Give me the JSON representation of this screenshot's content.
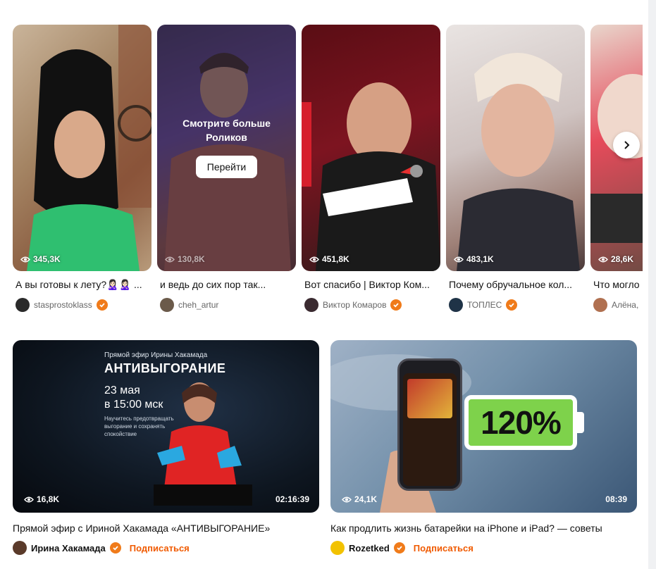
{
  "shorts": [
    {
      "views": "345,3K",
      "title": "А вы готовы к лету?🙎🏻‍♀️🙎🏻‍♀️ ...",
      "channel": "stasprostoklass",
      "verified": true,
      "avatar_color": "#2a2a2a"
    },
    {
      "views": "130,8K",
      "title": "и ведь до сих пор так...",
      "channel": "cheh_artur",
      "verified": false,
      "avatar_color": "#6b5a4a",
      "overlay": {
        "text": "Смотрите больше Роликов",
        "button": "Перейти"
      }
    },
    {
      "views": "451,8K",
      "title": "Вот спасибо | Виктор Ком...",
      "channel": "Виктор Комаров",
      "verified": true,
      "avatar_color": "#3a2a30"
    },
    {
      "views": "483,1K",
      "title": "Почему обручальное кол...",
      "channel": "ТОПЛЕС",
      "verified": true,
      "avatar_color": "#1f3347"
    },
    {
      "views": "28,6K",
      "title": "Что могло",
      "channel": "Алёна,",
      "verified": false,
      "avatar_color": "#b07050"
    }
  ],
  "videos": [
    {
      "views": "16,8K",
      "duration": "02:16:39",
      "title": "Прямой эфир с Ириной Хакамада «АНТИВЫГОРАНИЕ»",
      "channel": "Ирина Хакамада",
      "verified": true,
      "subscribe": "Подписаться",
      "avatar_color": "#5a3a2a",
      "thumb": {
        "small": "Прямой эфир Ирины Хакамада",
        "big": "АНТИВЫГОРАНИЕ",
        "date1": "23 мая",
        "date2": "в 15:00 мск",
        "desc": "Научитесь предотвращать выгорание и сохранять спокойствие"
      }
    },
    {
      "views": "24,1K",
      "duration": "08:39",
      "title": "Как продлить жизнь батарейки на iPhone и iPad? — советы",
      "channel": "Rozetked",
      "verified": true,
      "subscribe": "Подписаться",
      "avatar_color": "#f2c200",
      "thumb": {
        "battery": "120%"
      }
    }
  ],
  "colors": {
    "accent": "#f05a00",
    "verified": "#f07b1a"
  }
}
